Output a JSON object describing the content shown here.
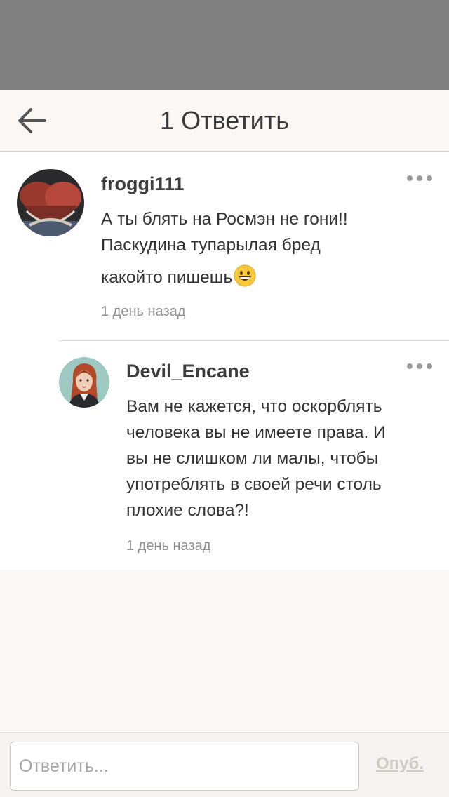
{
  "nav": {
    "title": "1 Ответить",
    "back_icon": "arrow-left-icon"
  },
  "comment": {
    "author": "froggi111",
    "text_line1": "А ты блять на Росмэн не гони!!",
    "text_line2": "Паскудина тупарылая бред",
    "text_line3": "какойто пишешь",
    "emoji": "grinning-face-emoji",
    "time": "1 день назад",
    "more_icon": "more-dots-icon"
  },
  "reply": {
    "author": "Devil_Encane",
    "text": "Вам не кажется, что оскорблять\nчеловека вы не имеете права. И\nвы не слишком ли малы, чтобы\nупотреблять в своей речи столь\nплохие слова?!",
    "time": "1 день назад",
    "more_icon": "more-dots-icon"
  },
  "composer": {
    "placeholder": "Ответить...",
    "publish_label": "Опуб."
  },
  "colors": {
    "status_bar": "#808080",
    "background": "#faf7f4",
    "card": "#ffffff",
    "text": "#333333",
    "muted": "#8e8e8e"
  }
}
